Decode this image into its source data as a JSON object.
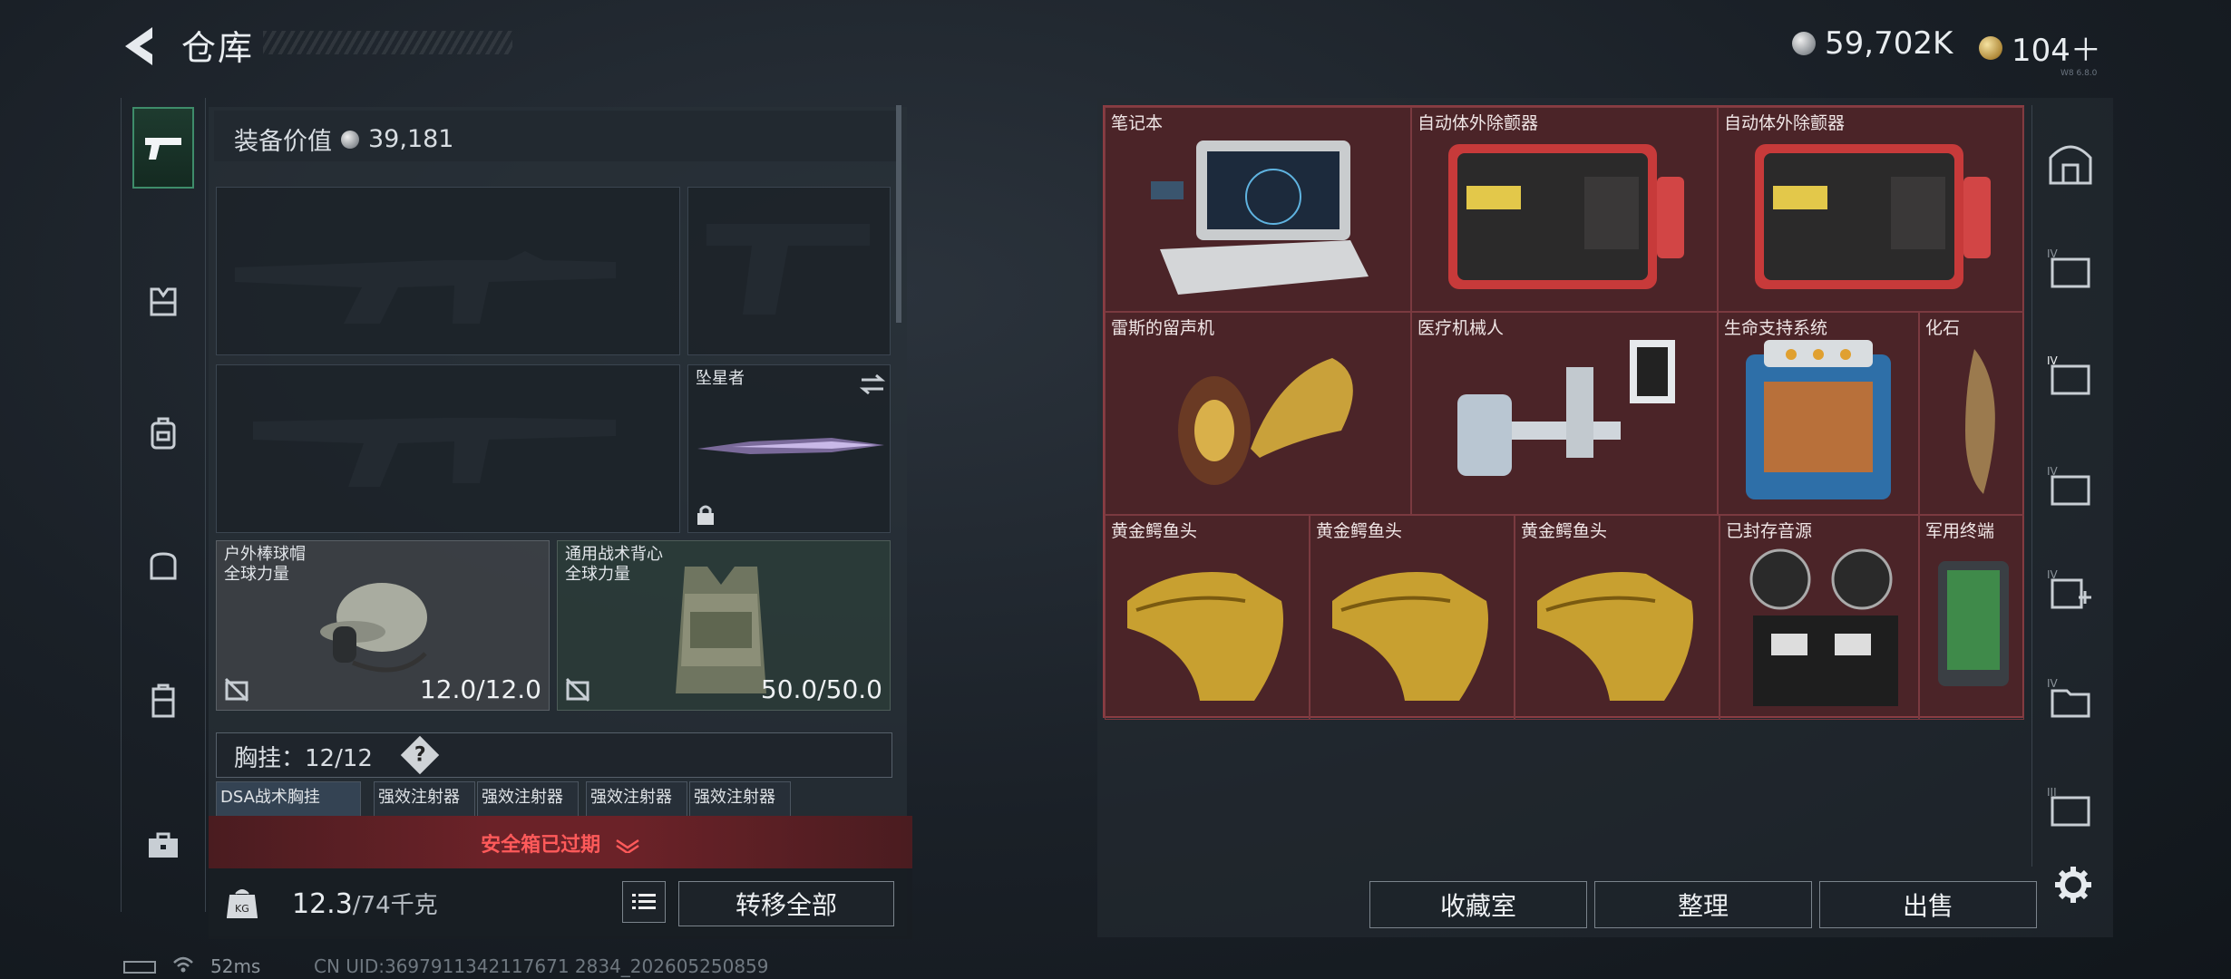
{
  "header": {
    "title": "仓库",
    "silver_amount": "59,702K",
    "gold_amount": "104＋",
    "tag": "W8 6.8.0"
  },
  "left_nav": {
    "items": [
      "pistol-icon",
      "vest-icon",
      "backpack-icon",
      "bag-icon",
      "locker-icon",
      "briefcase-icon"
    ],
    "active": 0
  },
  "equip": {
    "value_label": "装备价值",
    "value": "39,181"
  },
  "slots": {
    "melee_name": "坠星者",
    "helmet": {
      "name": "户外棒球帽",
      "sub": "全球力量",
      "durability": "12.0/12.0"
    },
    "armor": {
      "name": "通用战术背心",
      "sub": "全球力量",
      "durability": "50.0/50.0"
    }
  },
  "rig": {
    "label": "胸挂：",
    "capacity": "12/12",
    "help": "?",
    "items": [
      "DSA战术胸挂",
      "强效注射器",
      "强效注射器",
      "强效注射器",
      "强效注射器"
    ]
  },
  "safebox": {
    "status": "安全箱已过期"
  },
  "weight": {
    "current": "12.3",
    "max": "/74千克"
  },
  "buttons": {
    "transfer_all": "转移全部",
    "collection": "收藏室",
    "organize": "整理",
    "sell": "出售"
  },
  "grid_items": [
    {
      "name": "笔记本"
    },
    {
      "name": "自动体外除颤器"
    },
    {
      "name": "自动体外除颤器"
    },
    {
      "name": "雷斯的留声机"
    },
    {
      "name": "医疗机械人"
    },
    {
      "name": "生命支持系统"
    },
    {
      "name": "化石"
    },
    {
      "name": "黄金鳄鱼头"
    },
    {
      "name": "黄金鳄鱼头"
    },
    {
      "name": "黄金鳄鱼头"
    },
    {
      "name": "已封存音源"
    },
    {
      "name": "军用终端"
    }
  ],
  "status": {
    "ping": "52ms",
    "uid": "CN UID:3697911342117671 2834_202605250859"
  }
}
